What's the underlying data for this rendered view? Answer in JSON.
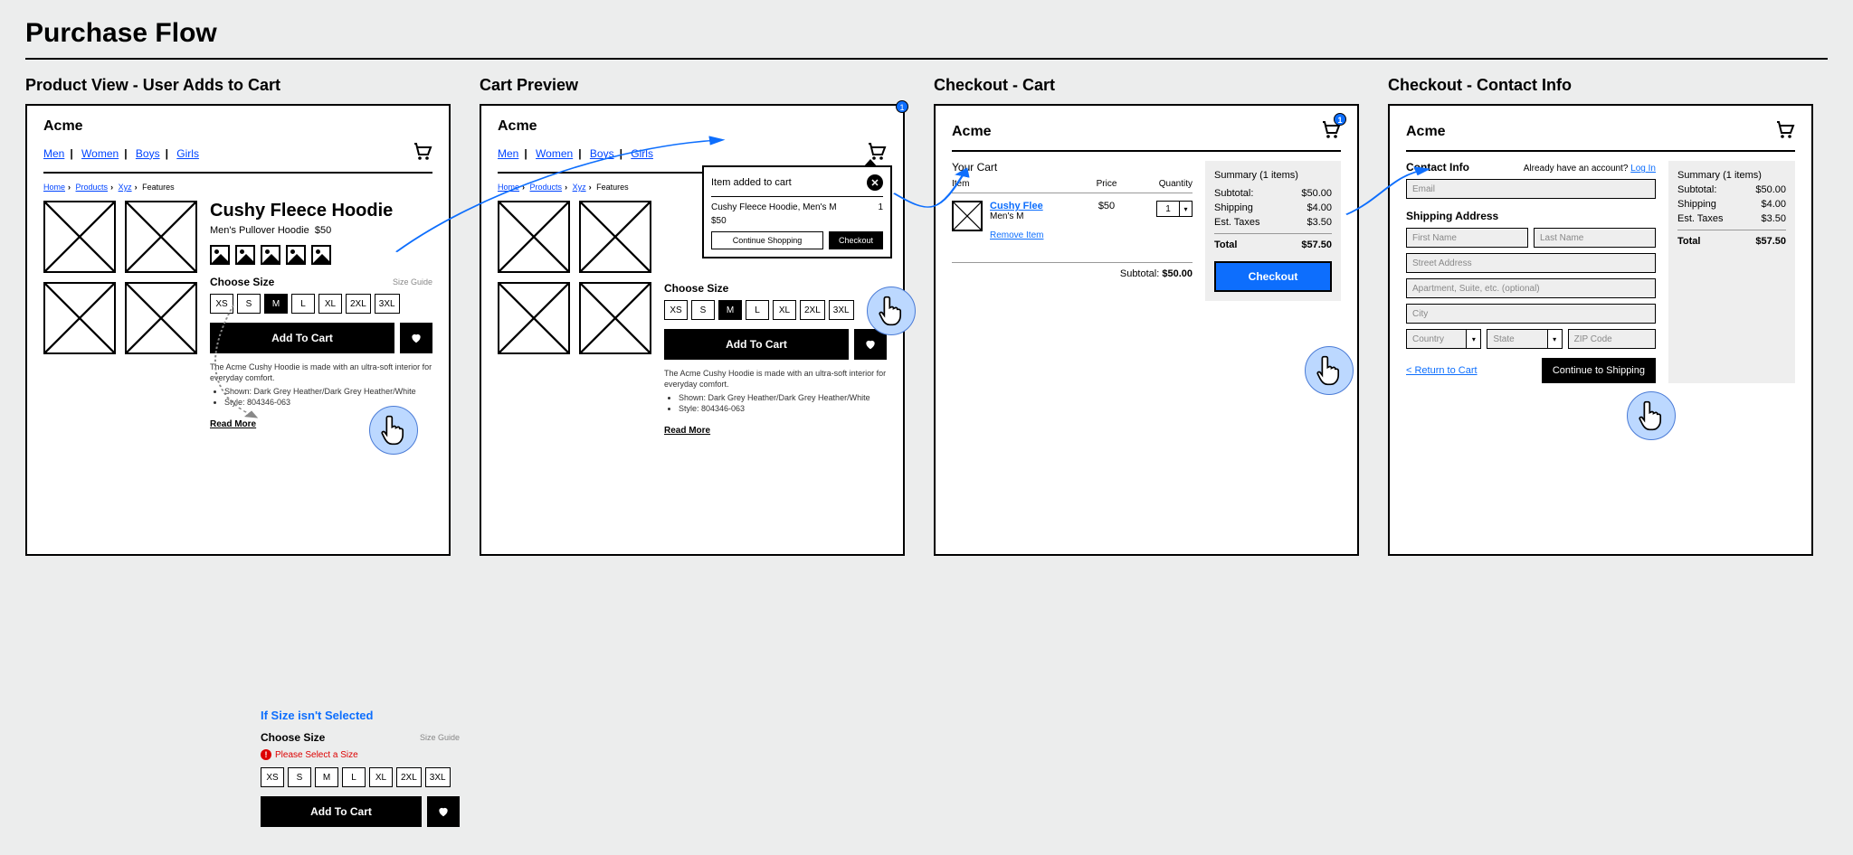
{
  "flow_title": "Purchase Flow",
  "screens": {
    "s1": {
      "title": "Product View - User Adds to Cart"
    },
    "s2": {
      "title": "Cart Preview"
    },
    "s3": {
      "title": "Checkout - Cart"
    },
    "s4": {
      "title": "Checkout - Contact Info"
    }
  },
  "brand": "Acme",
  "nav": {
    "men": "Men",
    "women": "Women",
    "boys": "Boys",
    "girls": "Girls"
  },
  "crumbs": {
    "home": "Home",
    "products": "Products",
    "xyz": "Xyz",
    "features": "Features"
  },
  "product": {
    "name": "Cushy Fleece Hoodie",
    "subtitle": "Men's Pullover Hoodie",
    "price": "$50",
    "choose_size": "Choose Size",
    "size_guide": "Size Guide",
    "sizes": [
      "XS",
      "S",
      "M",
      "L",
      "XL",
      "2XL",
      "3XL"
    ],
    "selected_size": "M",
    "add_to_cart": "Add To Cart",
    "desc_line1": "The Acme Cushy Hoodie is made with an ultra-soft interior for everyday comfort.",
    "desc_shown": "Shown: Dark Grey Heather/Dark Grey Heather/White",
    "desc_style": "Style: 804346-063",
    "read_more": "Read More"
  },
  "popover": {
    "title": "Item added to cart",
    "line1": "Cushy Fleece Hoodie, Men's M",
    "qty": "1",
    "price": "$50",
    "continue": "Continue Shopping",
    "checkout": "Checkout"
  },
  "cart_badge": "1",
  "cart": {
    "your_cart": "Your Cart",
    "col_item": "Item",
    "col_price": "Price",
    "col_qty": "Quantity",
    "item_name": "Cushy Flee",
    "item_sub": "Men's M",
    "item_price": "$50",
    "item_qty": "1",
    "remove": "Remove Item",
    "subtotal_label": "Subtotal:",
    "subtotal_value": "$50.00"
  },
  "summary": {
    "title": "Summary (1 items)",
    "subtotal_l": "Subtotal:",
    "subtotal_v": "$50.00",
    "shipping_l": "Shipping",
    "shipping_v": "$4.00",
    "tax_l": "Est. Taxes",
    "tax_v": "$3.50",
    "total_l": "Total",
    "total_v": "$57.50",
    "checkout_btn": "Checkout"
  },
  "contact": {
    "title": "Contact Info",
    "already": "Already have an account?",
    "login": "Log In",
    "email_ph": "Email",
    "ship_title": "Shipping Address",
    "first_ph": "First Name",
    "last_ph": "Last Name",
    "street_ph": "Street Address",
    "apt_ph": "Apartment, Suite, etc. (optional)",
    "city_ph": "City",
    "country_ph": "Country",
    "state_ph": "State",
    "zip_ph": "ZIP Code",
    "return": "< Return to Cart",
    "continue": "Continue to Shipping"
  },
  "error_variant": {
    "title": "If Size isn't Selected",
    "choose_size": "Choose Size",
    "size_guide": "Size Guide",
    "msg": "Please Select a Size",
    "add": "Add To Cart"
  }
}
